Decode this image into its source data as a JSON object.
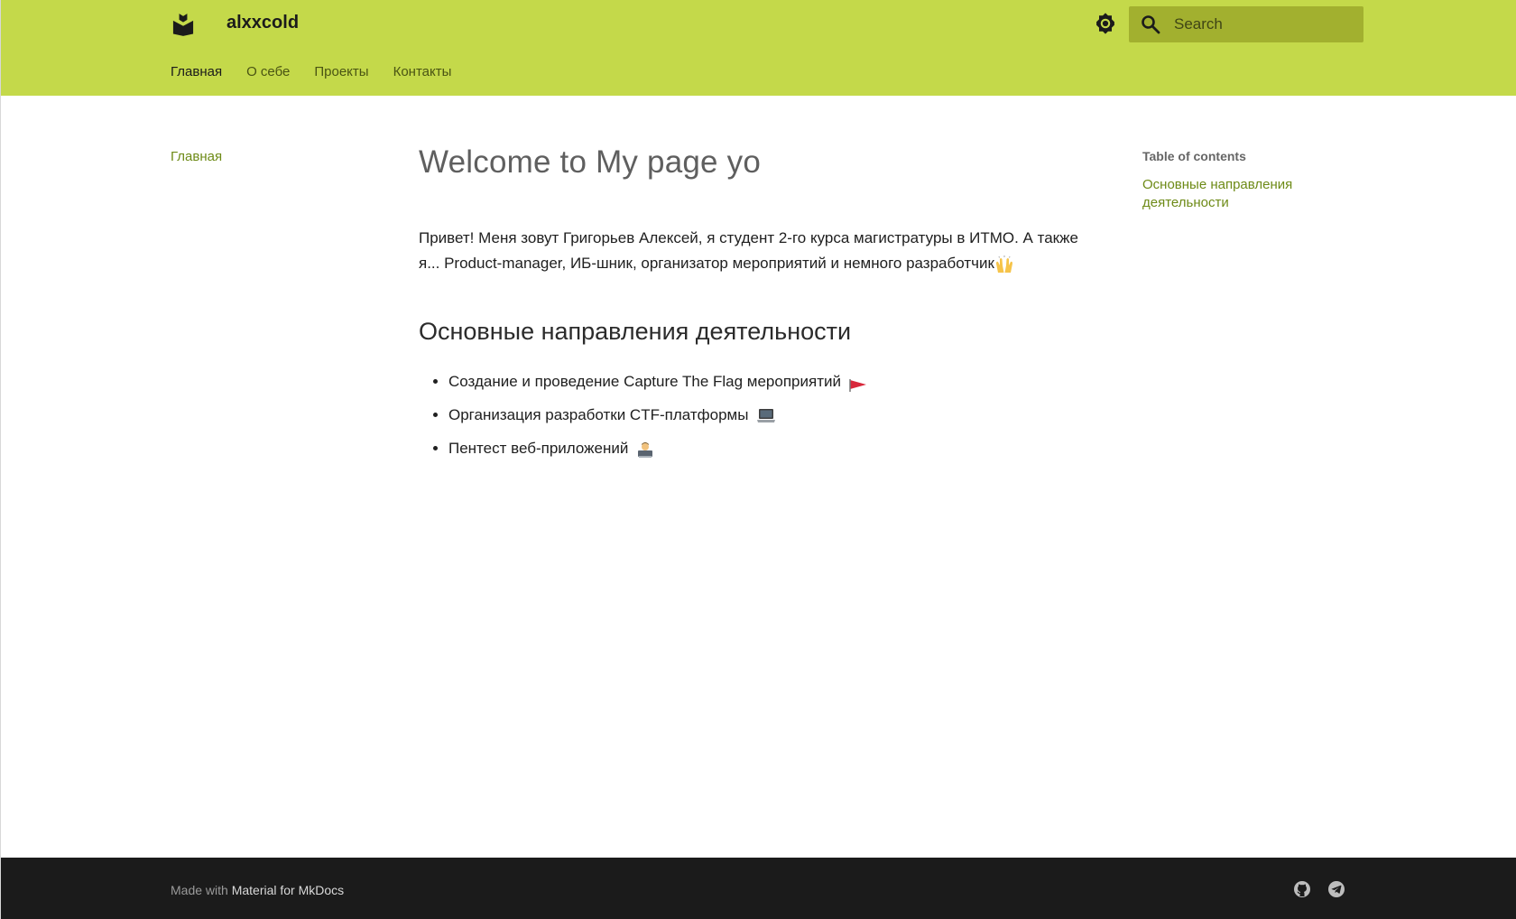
{
  "header": {
    "site_title": "alxxcold",
    "search_placeholder": "Search",
    "tabs": [
      {
        "label": "Главная",
        "active": true
      },
      {
        "label": "О себе",
        "active": false
      },
      {
        "label": "Проекты",
        "active": false
      },
      {
        "label": "Контакты",
        "active": false
      }
    ],
    "icons": {
      "logo": "book-icon",
      "theme": "brightness-icon",
      "search": "search-icon"
    }
  },
  "sidebar": {
    "items": [
      {
        "label": "Главная"
      }
    ]
  },
  "main": {
    "title": "Welcome to My page yo",
    "intro": "Привет! Меня зовут Григорьев Алексей, я студент 2-го курса магистратуры в ИТМО. А также я... Product-manager, ИБ-шник, организатор мероприятий и немного разработчик",
    "section_title": "Основные направления деятельности",
    "activities": [
      {
        "text": "Создание и проведение Capture The Flag мероприятий",
        "icon": "red-flag-icon"
      },
      {
        "text": "Организация разработки CTF-платформы",
        "icon": "laptop-icon"
      },
      {
        "text": "Пентест веб-приложений",
        "icon": "hacker-icon"
      }
    ]
  },
  "toc": {
    "title": "Table of contents",
    "links": [
      {
        "label": "Основные направления деятельности"
      }
    ]
  },
  "footer": {
    "made_with": "Made with",
    "link_text": "Material for MkDocs",
    "social": [
      "github-icon",
      "telegram-icon"
    ]
  },
  "colors": {
    "header_bg": "#c4d94a",
    "accent": "#6d8a16",
    "footer_bg": "#1b1b1b",
    "search_bg": "#a2b02f"
  }
}
